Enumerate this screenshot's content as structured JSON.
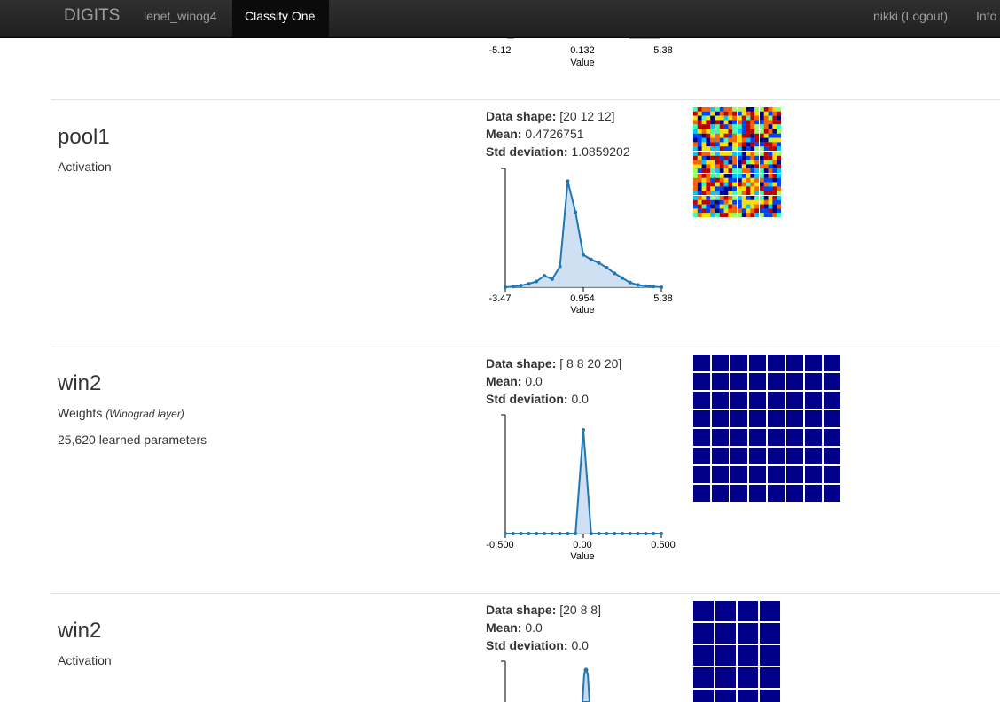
{
  "navbar": {
    "brand": "DIGITS",
    "job": "lenet_winog4",
    "active": "Classify One",
    "user": "nikki (Logout)",
    "info": "Info"
  },
  "top_partial": {
    "ticks": [
      "-5.12",
      "0.132",
      "5.38"
    ],
    "xlabel": "Value"
  },
  "layers": [
    {
      "name": "pool1",
      "type": "Activation",
      "shape_label": "Data shape:",
      "shape": "[20 12 12]",
      "mean_label": "Mean:",
      "mean": "0.4726751",
      "std_label": "Std deviation:",
      "std": "1.0859202",
      "ticks": [
        "-3.47",
        "0.954",
        "5.38"
      ],
      "xlabel": "Value"
    },
    {
      "name": "win2",
      "type": "Weights",
      "type_note": "(Winograd layer)",
      "params": "25,620 learned parameters",
      "shape_label": "Data shape:",
      "shape": "[ 8 8 20 20]",
      "mean_label": "Mean:",
      "mean": "0.0",
      "std_label": "Std deviation:",
      "std": "0.0",
      "ticks": [
        "-0.500",
        "0.00",
        "0.500"
      ],
      "xlabel": "Value"
    },
    {
      "name": "win2",
      "type": "Activation",
      "shape_label": "Data shape:",
      "shape": "[20 8 8]",
      "mean_label": "Mean:",
      "mean": "0.0",
      "std_label": "Std deviation:",
      "std": "0.0"
    }
  ],
  "colors": {
    "navbar": "#222222",
    "line": "#1f77b4",
    "fill": "#c6dbef",
    "grid_cell": "#00008b",
    "grid_line": "#ffffff"
  },
  "chart_data": [
    {
      "type": "area",
      "title": "",
      "xlabel": "Value",
      "xlim": [
        -3.47,
        5.38
      ],
      "x": [
        -3.47,
        -3.03,
        -2.59,
        -2.14,
        -1.7,
        -1.26,
        -0.81,
        -0.37,
        0.07,
        0.51,
        0.95,
        1.4,
        1.84,
        2.28,
        2.73,
        3.17,
        3.61,
        4.05,
        4.5,
        4.94,
        5.38
      ],
      "values": [
        0,
        0.005,
        0.015,
        0.03,
        0.05,
        0.1,
        0.07,
        0.18,
        0.92,
        0.65,
        0.28,
        0.24,
        0.21,
        0.17,
        0.12,
        0.08,
        0.04,
        0.02,
        0.01,
        0.005,
        0
      ]
    },
    {
      "type": "area",
      "title": "",
      "xlabel": "Value",
      "xlim": [
        -0.5,
        0.5
      ],
      "x": [
        -0.5,
        -0.45,
        -0.4,
        -0.35,
        -0.3,
        -0.25,
        -0.2,
        -0.15,
        -0.1,
        -0.05,
        0.0,
        0.05,
        0.1,
        0.15,
        0.2,
        0.25,
        0.3,
        0.35,
        0.4,
        0.45,
        0.5
      ],
      "values": [
        0,
        0,
        0,
        0,
        0,
        0,
        0,
        0,
        0,
        0,
        0.9,
        0,
        0,
        0,
        0,
        0,
        0,
        0,
        0,
        0,
        0
      ]
    }
  ]
}
